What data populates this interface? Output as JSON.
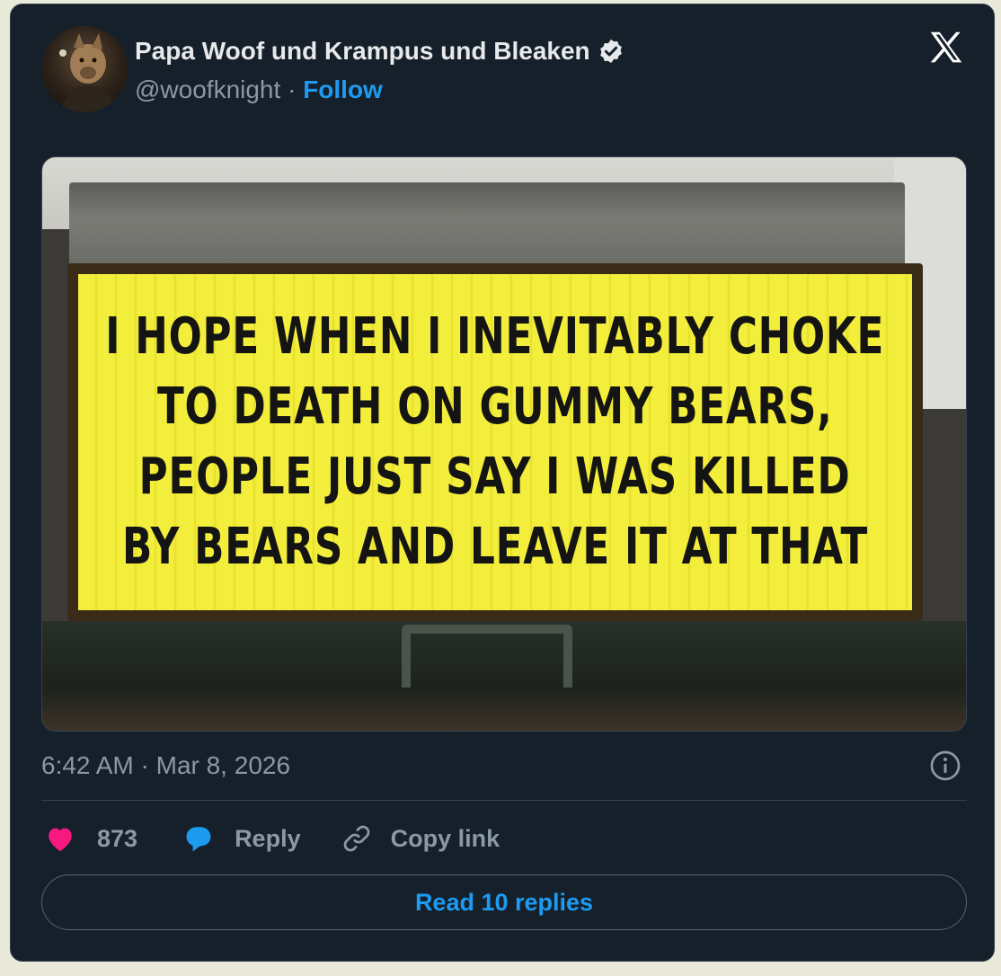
{
  "author": {
    "name": "Papa Woof und Krampus und Bleaken",
    "handle": "@woofknight",
    "separator": "·",
    "follow_label": "Follow"
  },
  "media": {
    "sign_lines": [
      "I HOPE WHEN I INEVITABLY CHOKE",
      "TO DEATH ON GUMMY BEARS,",
      "PEOPLE JUST SAY I WAS KILLED",
      "BY BEARS AND LEAVE IT AT THAT"
    ]
  },
  "timestamp": "6:42 AM · Mar 8, 2026",
  "actions": {
    "like_count": "873",
    "reply_label": "Reply",
    "copy_label": "Copy link"
  },
  "read_replies_label": "Read 10 replies",
  "icons": {
    "brand": "x-logo-icon",
    "verified": "verified-badge-icon",
    "info": "info-icon",
    "like": "heart-icon",
    "reply": "speech-bubble-icon",
    "copy": "link-icon"
  },
  "colors": {
    "background": "#15202b",
    "accent": "#1d9bf0",
    "like": "#f91880",
    "muted_text": "#8b98a5",
    "sign_yellow": "#f3ee3c"
  }
}
